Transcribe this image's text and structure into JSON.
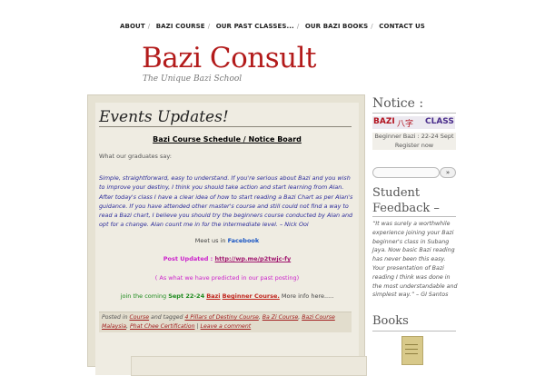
{
  "nav": {
    "items": [
      "ABOUT",
      "BAZI COURSE",
      "OUR PAST CLASSES...",
      "OUR BAZI BOOKS",
      "CONTACT US"
    ]
  },
  "site": {
    "title": "Bazi Consult",
    "tagline": "The Unique Bazi School"
  },
  "post": {
    "title": "Events Updates!",
    "schedule": "Bazi Course Schedule / Notice Board",
    "graduates": "What our graduates say:",
    "quote": "Simple, straightforward, easy to understand. If you're serious about Bazi and you wish to improve your destiny, I think you should take action and start learning from Alan. After today's class I have a clear idea of how to start reading a Bazi Chart as per Alan's guidance. If you have attended other master's course and still could not find a way to read a Bazi chart, I believe you should try the beginners course conducted by Alan and opt for a change. Alan count me in for the intermediate level. – Nick Ooi",
    "meet_prefix": "Meet us in ",
    "meet_link": "Facebook",
    "posted_prefix": "Post Updated : ",
    "posted_link": "http://wp.me/p2twjc-fy",
    "predicted": "( As what we have predicted in our past posting)",
    "coming_prefix": "join the coming ",
    "coming_date": "Sept 22-24",
    "coming_bazi": "Bazi",
    "coming_course": "Beginner  Course.",
    "coming_more": " More info here.....",
    "meta_posted_in": "Posted in ",
    "meta_course": "Course",
    "meta_tagged": " and tagged ",
    "meta_tag1": "4 Pillars of Destiny Course",
    "meta_tag2": "Ba Zi Course",
    "meta_tag3": "Bazi Course Malaysia",
    "meta_tag4": "Phat Chee Certification",
    "meta_comment": "Leave a comment"
  },
  "sidebar": {
    "notice_title": "Notice :",
    "banner_left": "BAZI",
    "banner_mid": "八字",
    "banner_right": "CLASS",
    "beginner_line1": "Beginner Bazi : 22-24 Sept",
    "beginner_line2": "Register now",
    "search_button": "»",
    "student_title_1": "Student",
    "student_title_2": "Feedback –",
    "feedback_quote": "“It was surely a worthwhile experience joining your Bazi beginner's class in Subang Jaya. Now basic Bazi reading has never been this easy. Your presentation of Bazi reading I think was done in the most understandable and simplest way.” – GI Santos",
    "books_title": "Books"
  }
}
